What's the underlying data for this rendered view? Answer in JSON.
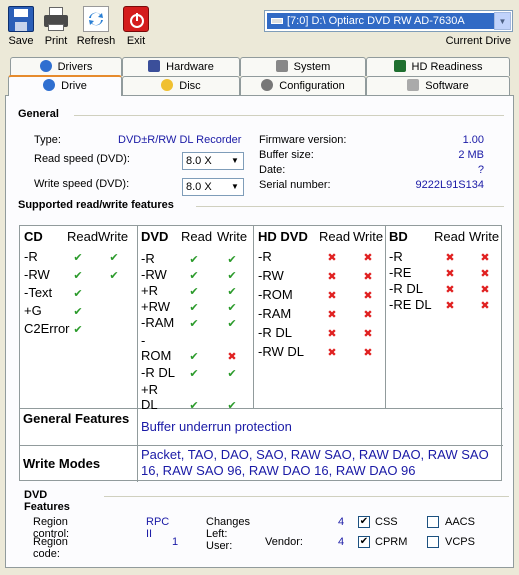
{
  "toolbar": {
    "save": "Save",
    "print": "Print",
    "refresh": "Refresh",
    "exit": "Exit"
  },
  "drive_selector": {
    "value": "[7:0]  D:\\ Optiarc  DVD RW AD-7630A",
    "caption": "Current Drive"
  },
  "tabs": {
    "row1": [
      "Drivers",
      "Hardware",
      "System",
      "HD Readiness"
    ],
    "row2": [
      "Drive",
      "Disc",
      "Configuration",
      "Software"
    ]
  },
  "general": {
    "title": "General",
    "type_label": "Type:",
    "type_value": "DVD±R/RW DL Recorder",
    "read_speed_label": "Read speed (DVD):",
    "read_speed_value": "8.0 X",
    "write_speed_label": "Write speed (DVD):",
    "write_speed_value": "8.0 X",
    "firmware_label": "Firmware version:",
    "firmware_value": "1.00",
    "buffer_label": "Buffer size:",
    "buffer_value": "2 MB",
    "date_label": "Date:",
    "date_value": "?",
    "serial_label": "Serial number:",
    "serial_value": "9222L91S134"
  },
  "rw_features": {
    "title": "Supported read/write features",
    "read_header": "Read",
    "write_header": "Write",
    "groups": [
      {
        "name": "CD",
        "items": [
          {
            "label": "-R",
            "read": "ok",
            "write": "ok"
          },
          {
            "label": "-RW",
            "read": "ok",
            "write": "ok"
          },
          {
            "label": "-Text",
            "read": "ok",
            "write": ""
          },
          {
            "label": "+G",
            "read": "ok",
            "write": ""
          },
          {
            "label": "C2Error",
            "read": "ok",
            "write": ""
          }
        ]
      },
      {
        "name": "DVD",
        "items": [
          {
            "label": "-R",
            "read": "ok",
            "write": "ok"
          },
          {
            "label": "-RW",
            "read": "ok",
            "write": "ok"
          },
          {
            "label": "+R",
            "read": "ok",
            "write": "ok"
          },
          {
            "label": "+RW",
            "read": "ok",
            "write": "ok"
          },
          {
            "label": "-RAM",
            "read": "ok",
            "write": "ok"
          },
          {
            "label": "-",
            "read": "",
            "write": ""
          },
          {
            "label": "ROM",
            "read": "ok",
            "write": "no"
          },
          {
            "label": "-R DL",
            "read": "ok",
            "write": "ok"
          },
          {
            "label": "+R",
            "read": "",
            "write": ""
          },
          {
            "label": "DL",
            "read": "ok",
            "write": "ok"
          }
        ]
      },
      {
        "name": "HD DVD",
        "items": [
          {
            "label": "-R",
            "read": "no",
            "write": "no"
          },
          {
            "label": "-RW",
            "read": "no",
            "write": "no"
          },
          {
            "label": "-ROM",
            "read": "no",
            "write": "no"
          },
          {
            "label": "-RAM",
            "read": "no",
            "write": "no"
          },
          {
            "label": "-R DL",
            "read": "no",
            "write": "no"
          },
          {
            "label": "-RW DL",
            "read": "no",
            "write": "no"
          }
        ]
      },
      {
        "name": "BD",
        "items": [
          {
            "label": "-R",
            "read": "no",
            "write": "no"
          },
          {
            "label": "-RE",
            "read": "no",
            "write": "no"
          },
          {
            "label": "-R DL",
            "read": "no",
            "write": "no"
          },
          {
            "label": "-RE DL",
            "read": "no",
            "write": "no"
          }
        ]
      }
    ],
    "general_features_label": "General Features",
    "general_features_value": "Buffer underrun protection",
    "write_modes_label": "Write Modes",
    "write_modes_value": "Packet, TAO, DAO, SAO, RAW SAO, RAW DAO, RAW SAO 16, RAW SAO 96, RAW DAO 16, RAW DAO 96"
  },
  "dvd_features": {
    "title": "DVD Features",
    "region_control_label": "Region control:",
    "region_control_value": "RPC II",
    "region_code_label": "Region code:",
    "region_code_value": "1",
    "changes_user_label": "Changes Left: User:",
    "changes_user_value": "4",
    "vendor_label": "Vendor:",
    "vendor_value": "4",
    "css_label": "CSS",
    "css_checked": true,
    "aacs_label": "AACS",
    "aacs_checked": false,
    "cprm_label": "CPRM",
    "cprm_checked": true,
    "vcps_label": "VCPS",
    "vcps_checked": false
  },
  "colors": {
    "ok": "#2a9a2a",
    "no": "#e02020",
    "value_text": "#1a1aa6",
    "selection": "#316ac5"
  }
}
